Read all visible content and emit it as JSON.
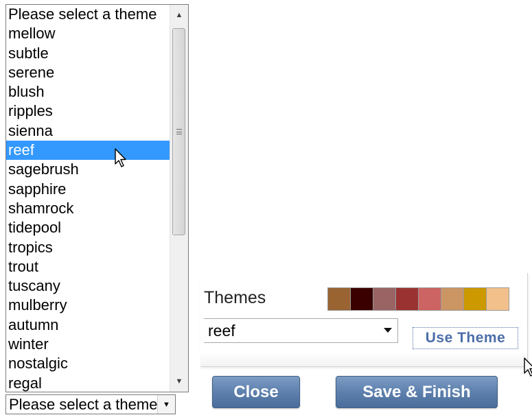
{
  "theme_list": {
    "items": [
      "Please select a theme",
      "mellow",
      "subtle",
      "serene",
      "blush",
      "ripples",
      "sienna",
      "reef",
      "sagebrush",
      "sapphire",
      "shamrock",
      "tidepool",
      "tropics",
      "trout",
      "tuscany",
      "mulberry",
      "autumn",
      "winter",
      "nostalgic",
      "regal"
    ],
    "highlighted": "reef"
  },
  "collapsed_select": {
    "value": "Please select a theme"
  },
  "themes_panel": {
    "label": "Themes",
    "swatches": [
      "#9a6432",
      "#3a0000",
      "#9a6464",
      "#9a3232",
      "#cc6464",
      "#cc9664",
      "#cc9a00",
      "#f2c08a"
    ],
    "selected_value": "reef",
    "use_theme_label": "Use Theme"
  },
  "buttons": {
    "close_label": "Close",
    "save_label": "Save & Finish"
  },
  "icons": {
    "scroll_up": "scroll-up-arrow-icon",
    "scroll_down": "scroll-down-arrow-icon",
    "dropdown_arrow": "chevron-down-icon",
    "cursor": "mouse-pointer-icon"
  }
}
